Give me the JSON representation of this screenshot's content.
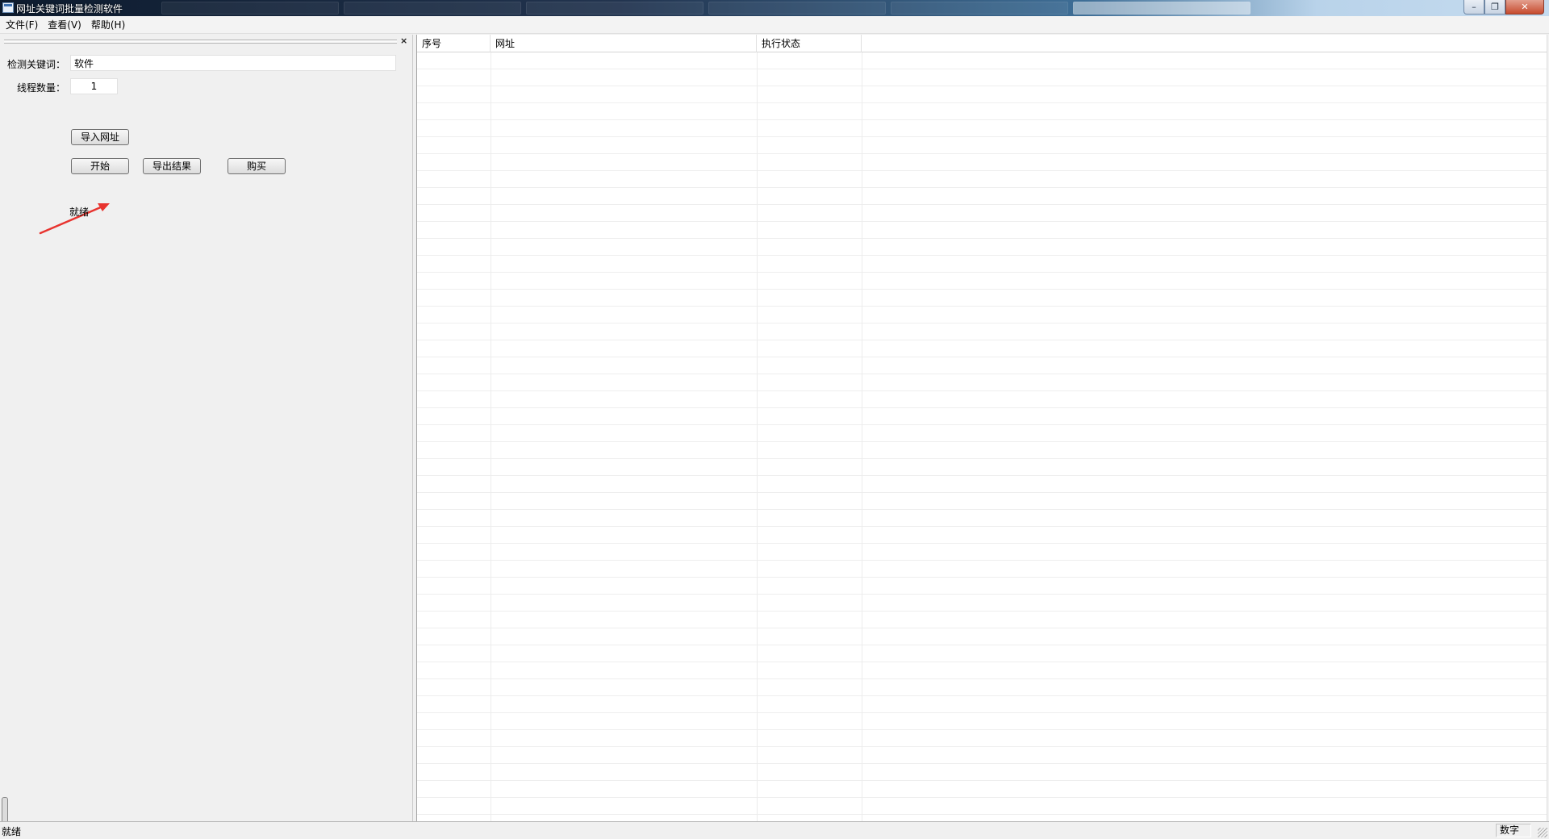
{
  "window": {
    "title": "网址关键词批量检测软件"
  },
  "menubar": {
    "items": [
      {
        "label": "文件(F)"
      },
      {
        "label": "查看(V)"
      },
      {
        "label": "帮助(H)"
      }
    ]
  },
  "panel": {
    "close_glyph": "×",
    "keyword_label": "检测关键词：",
    "keyword_value": "软件",
    "thread_label": "线程数量：",
    "thread_value": "1",
    "import_button": "导入网址",
    "start_button": "开始",
    "export_button": "导出结果",
    "buy_button": "购买",
    "status": "就绪",
    "annotation_arrow_color": "#e8342f",
    "progress_fraction": 0.4
  },
  "list": {
    "columns": [
      {
        "label": "序号"
      },
      {
        "label": "网址"
      },
      {
        "label": "执行状态"
      }
    ]
  },
  "statusbar": {
    "status": "就绪",
    "indicator": "数字"
  }
}
